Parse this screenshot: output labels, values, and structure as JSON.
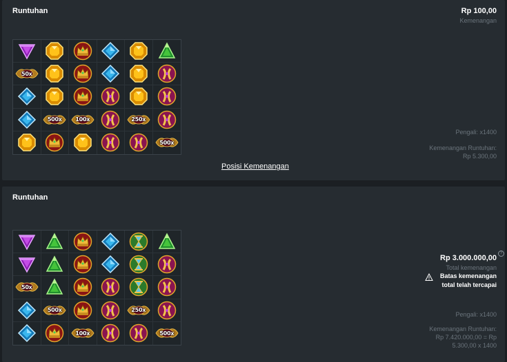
{
  "cards": [
    {
      "title": "Runtuhan",
      "win_amount": "Rp 100,00",
      "win_caption": "Kemenangan",
      "multiplier_text": "Pengali: x1400",
      "tumble_label": "Kemenangan Runtuhan:",
      "tumble_value": "Rp 5.300,00",
      "win_positions_link": "Posisi Kemenangan",
      "grid": [
        [
          "purple-gem",
          "yellow-gem",
          "crown",
          "blue-gem",
          "yellow-gem",
          "green-gem"
        ],
        [
          "m50",
          "yellow-gem",
          "crown",
          "blue-gem",
          "yellow-gem",
          "goblet"
        ],
        [
          "blue-gem",
          "yellow-gem",
          "crown",
          "goblet",
          "yellow-gem",
          "goblet"
        ],
        [
          "blue-gem",
          "m500",
          "m100",
          "goblet",
          "m250",
          "goblet"
        ],
        [
          "yellow-gem",
          "crown",
          "yellow-gem",
          "goblet",
          "goblet",
          "m500"
        ]
      ]
    },
    {
      "title": "Runtuhan",
      "total_amount": "Rp 3.000.000,00",
      "total_caption": "Total kemenangan",
      "limit_line1": "Batas kemenangan",
      "limit_line2": "total telah tercapai",
      "multiplier_text": "Pengali: x1400",
      "tumble_label": "Kemenangan Runtuhan:",
      "tumble_value_line1": "Rp 7.420.000,00 = Rp",
      "tumble_value_line2": "5.300,00 x 1400",
      "help_glyph": "?",
      "grid": [
        [
          "purple-gem",
          "green-gem",
          "crown",
          "blue-gem",
          "hourglass",
          "green-gem"
        ],
        [
          "purple-gem",
          "green-gem",
          "crown",
          "blue-gem",
          "hourglass",
          "goblet"
        ],
        [
          "m50",
          "green-gem",
          "crown",
          "goblet",
          "hourglass",
          "goblet"
        ],
        [
          "blue-gem",
          "m500",
          "crown",
          "goblet",
          "m250",
          "goblet"
        ],
        [
          "blue-gem",
          "crown",
          "m100",
          "goblet",
          "goblet",
          "m500"
        ]
      ]
    }
  ],
  "multiplier_labels": {
    "m50": "50x",
    "m100": "100x",
    "m250": "250x",
    "m500": "500x"
  },
  "colors": {
    "background": "#1b1f23",
    "card": "#262c31",
    "muted_text": "#6b747c",
    "text": "#ffffff"
  }
}
